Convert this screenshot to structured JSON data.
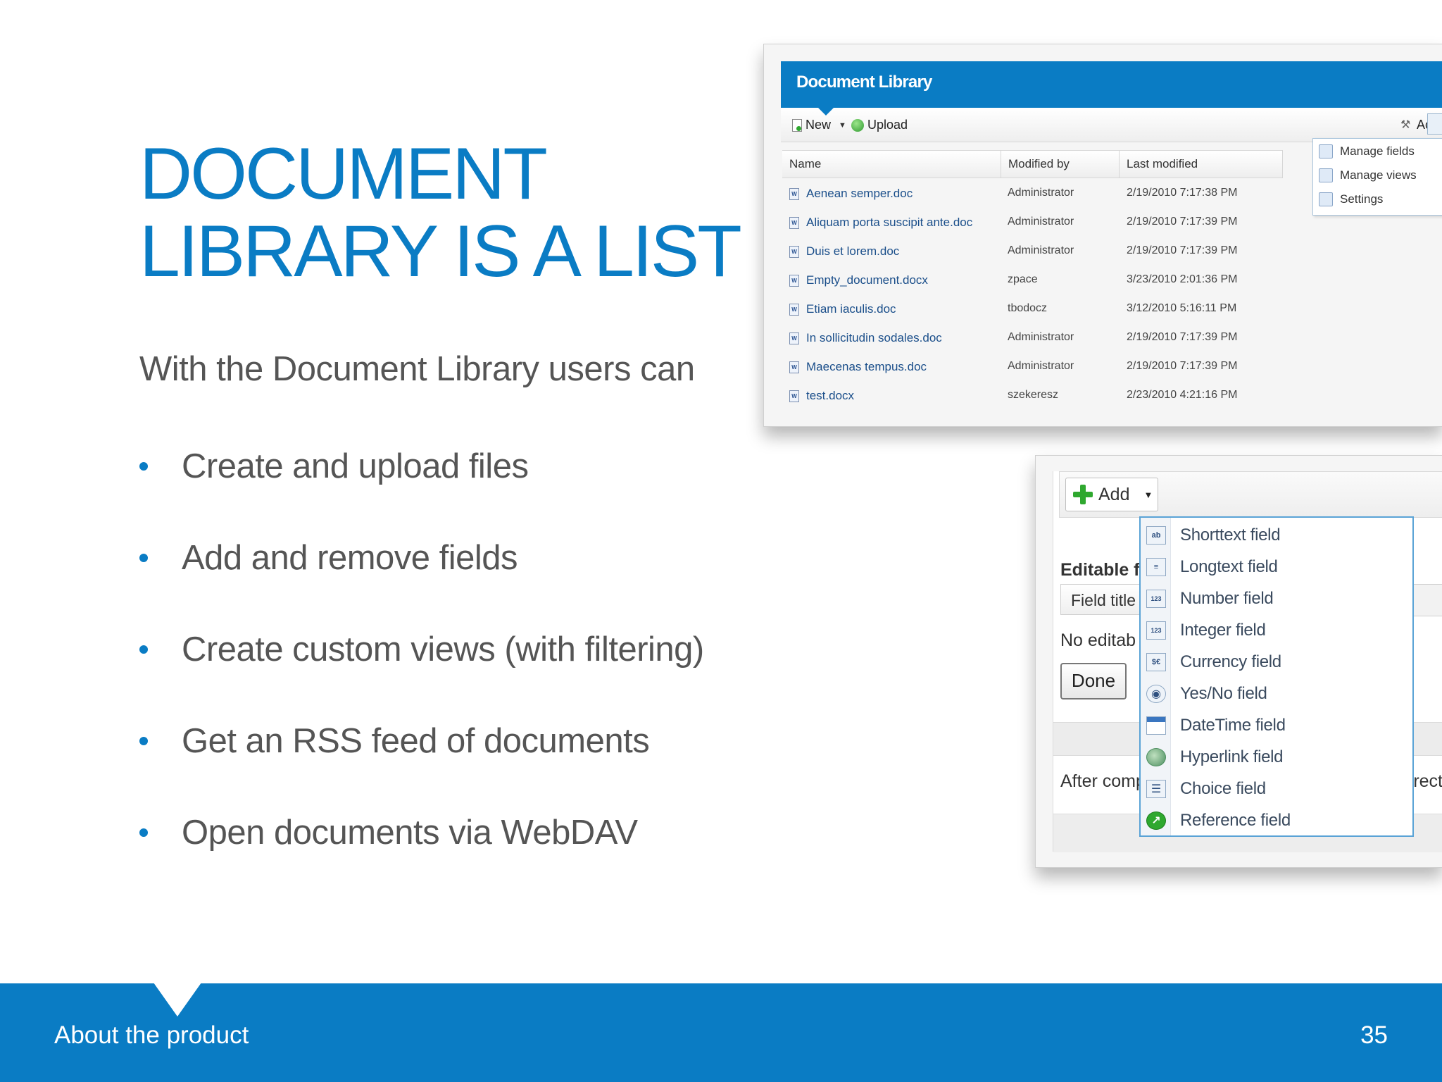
{
  "slide": {
    "title_line1": "DOCUMENT",
    "title_line2": "LIBRARY IS A LIST",
    "intro": "With the Document Library users can",
    "bullets": [
      "Create and upload files",
      "Add and remove fields",
      "Create custom views (with filtering)",
      "Get an RSS feed of documents",
      "Open documents via WebDAV"
    ],
    "footer_label": "About the product",
    "page_number": "35"
  },
  "doc_library": {
    "header_title": "Document Library",
    "toolbar": {
      "new_label": "New",
      "upload_label": "Upload",
      "actions_label": "Actions"
    },
    "columns": [
      "Name",
      "Modified by",
      "Last modified"
    ],
    "rows": [
      {
        "name": "Aenean semper.doc",
        "modified_by": "Administrator",
        "last_modified": "2/19/2010 7:17:38 PM"
      },
      {
        "name": "Aliquam porta suscipit ante.doc",
        "modified_by": "Administrator",
        "last_modified": "2/19/2010 7:17:39 PM"
      },
      {
        "name": "Duis et lorem.doc",
        "modified_by": "Administrator",
        "last_modified": "2/19/2010 7:17:39 PM"
      },
      {
        "name": "Empty_document.docx",
        "modified_by": "zpace",
        "last_modified": "3/23/2010 2:01:36 PM"
      },
      {
        "name": "Etiam iaculis.doc",
        "modified_by": "tbodocz",
        "last_modified": "3/12/2010 5:16:11 PM"
      },
      {
        "name": "In sollicitudin sodales.doc",
        "modified_by": "Administrator",
        "last_modified": "2/19/2010 7:17:39 PM"
      },
      {
        "name": "Maecenas tempus.doc",
        "modified_by": "Administrator",
        "last_modified": "2/19/2010 7:17:39 PM"
      },
      {
        "name": "test.docx",
        "modified_by": "szekeresz",
        "last_modified": "2/23/2010 4:21:16 PM"
      }
    ],
    "actions_menu": [
      "Manage fields",
      "Manage views",
      "Settings"
    ]
  },
  "fields_panel": {
    "add_label": "Add",
    "editable_label": "Editable f",
    "field_title": "Field title",
    "no_editable": "No editab",
    "done_label": "Done",
    "after_text": "After comp",
    "right_cut_text": "rect",
    "field_types": [
      {
        "label": "Shorttext field",
        "icon": "shorttext-icon",
        "glyph": "ab"
      },
      {
        "label": "Longtext field",
        "icon": "longtext-icon",
        "glyph": "≡"
      },
      {
        "label": "Number field",
        "icon": "number-icon",
        "glyph": "123"
      },
      {
        "label": "Integer field",
        "icon": "integer-icon",
        "glyph": "123"
      },
      {
        "label": "Currency field",
        "icon": "currency-icon",
        "glyph": "$€"
      },
      {
        "label": "Yes/No field",
        "icon": "yes-no-radio-icon",
        "glyph": "◉"
      },
      {
        "label": "DateTime field",
        "icon": "calendar-icon",
        "glyph": ""
      },
      {
        "label": "Hyperlink field",
        "icon": "hyperlink-globe-icon",
        "glyph": ""
      },
      {
        "label": "Choice field",
        "icon": "choice-list-icon",
        "glyph": "☰"
      },
      {
        "label": "Reference field",
        "icon": "reference-arrow-icon",
        "glyph": "↗"
      }
    ]
  }
}
